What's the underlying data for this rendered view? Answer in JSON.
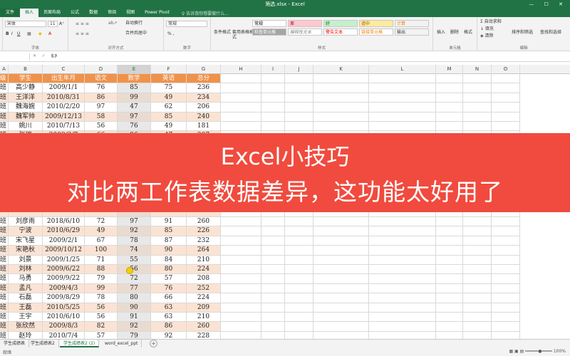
{
  "window": {
    "title": "筛选.xlsx - Excel",
    "controls": "— ☐ ✕"
  },
  "menu": {
    "file": "文件",
    "tabs": [
      "插入",
      "页面布局",
      "公式",
      "数据",
      "审阅",
      "视图",
      "Power Pivot"
    ],
    "active_index": 0,
    "tell_me": "♀ 告诉我你想要做什么..."
  },
  "ribbon": {
    "clipboard": {
      "paste": "粘贴",
      "cut": "✂",
      "copy": "⎘",
      "painter": "🖌"
    },
    "font": {
      "name": "宋体",
      "size": "11",
      "grow": "A⁺",
      "shrink": "A⁻",
      "bold": "B",
      "italic": "I",
      "underline": "U",
      "label": "字体"
    },
    "align": {
      "wrap": "自动换行",
      "merge": "合并后居中",
      "label": "对齐方式"
    },
    "number": {
      "format": "常规",
      "percent": "% ,",
      "label": "数字"
    },
    "styles": {
      "cond": "条件格式",
      "table": "套用表格格式",
      "label": "样式",
      "cells": [
        {
          "text": "常规",
          "bg": "#ffffff",
          "fg": "#000000"
        },
        {
          "text": "差",
          "bg": "#ffc7ce",
          "fg": "#9c0006"
        },
        {
          "text": "好",
          "bg": "#c6efce",
          "fg": "#006100"
        },
        {
          "text": "适中",
          "bg": "#ffeb9c",
          "fg": "#9c5700"
        },
        {
          "text": "计算",
          "bg": "#f2f2f2",
          "fg": "#fa7d00"
        },
        {
          "text": "检查单元格",
          "bg": "#a5a5a5",
          "fg": "#ffffff"
        },
        {
          "text": "解释性文本",
          "bg": "#ffffff",
          "fg": "#7f7f7f"
        },
        {
          "text": "警告文本",
          "bg": "#ffffff",
          "fg": "#ff0000"
        },
        {
          "text": "链接单元格",
          "bg": "#ffffff",
          "fg": "#fa7d00"
        },
        {
          "text": "输出",
          "bg": "#f2f2f2",
          "fg": "#3f3f3f"
        }
      ]
    },
    "cellsgrp": {
      "insert": "插入",
      "delete": "删除",
      "format": "格式",
      "label": "单元格"
    },
    "editing": {
      "autosum": "Σ 自动求和",
      "fill": "↓ 填充",
      "clear": "◈ 清除",
      "sort": "排序和筛选",
      "find": "查找和选择",
      "label": "编辑"
    }
  },
  "formula": {
    "namebox": "",
    "fx": "✕ ✓ fx",
    "value": "67"
  },
  "columns": [
    {
      "id": "",
      "w": 0
    },
    {
      "id": "A",
      "w": 0
    },
    {
      "id": "B",
      "w": 0
    },
    {
      "id": "C",
      "w": 0
    },
    {
      "id": "D",
      "w": 0
    },
    {
      "id": "E",
      "w": 0
    },
    {
      "id": "F",
      "w": 0
    },
    {
      "id": "G",
      "w": 0
    },
    {
      "id": "H",
      "w": 0
    },
    {
      "id": "I",
      "w": 0
    },
    {
      "id": "J",
      "w": 0
    },
    {
      "id": "K",
      "w": 0
    },
    {
      "id": "L",
      "w": 0
    },
    {
      "id": "M",
      "w": 0
    },
    {
      "id": "N",
      "w": 0
    },
    {
      "id": "O",
      "w": 0
    }
  ],
  "selected_column": "E",
  "table": {
    "header": [
      "级",
      "学生",
      "出生年月",
      "语文",
      "数学",
      "英语",
      "总分"
    ],
    "rows": [
      [
        "班",
        "高少静",
        "2009/1/1",
        "76",
        "85",
        "75",
        "236"
      ],
      [
        "班",
        "王洋洋",
        "2010/8/31",
        "86",
        "99",
        "49",
        "234"
      ],
      [
        "班",
        "魏海婉",
        "2010/2/20",
        "97",
        "47",
        "62",
        "206"
      ],
      [
        "班",
        "魏军帅",
        "2009/12/13",
        "58",
        "97",
        "85",
        "240"
      ],
      [
        "班",
        "姚川",
        "2010/7/13",
        "56",
        "76",
        "49",
        "181"
      ],
      [
        "班",
        "张瑞",
        "2009/3/7",
        "66",
        "96",
        "47",
        "207"
      ],
      [
        "",
        "",
        "",
        "",
        "",
        "",
        ""
      ],
      [
        "",
        "",
        "",
        "",
        "",
        "",
        ""
      ],
      [
        "",
        "",
        "",
        "",
        "",
        "",
        ""
      ],
      [
        "",
        "",
        "",
        "",
        "",
        "",
        ""
      ],
      [
        "",
        "",
        "",
        "",
        "",
        "",
        ""
      ],
      [
        "",
        "",
        "",
        "",
        "",
        "",
        ""
      ],
      [
        "",
        "",
        "",
        "",
        "",
        "",
        ""
      ],
      [
        "",
        "",
        "",
        "",
        "",
        "",
        ""
      ],
      [
        "班",
        "刘彦雨",
        "2018/6/10",
        "72",
        "97",
        "91",
        "260"
      ],
      [
        "班",
        "宁波",
        "2010/6/29",
        "49",
        "92",
        "85",
        "226"
      ],
      [
        "班",
        "宋飞星",
        "2009/2/1",
        "67",
        "78",
        "87",
        "232"
      ],
      [
        "班",
        "宋艳秋",
        "2009/10/12",
        "100",
        "74",
        "90",
        "264"
      ],
      [
        "班",
        "刘景",
        "2009/1/25",
        "71",
        "55",
        "84",
        "210"
      ],
      [
        "班",
        "刘林",
        "2009/6/22",
        "88",
        "56",
        "80",
        "224"
      ],
      [
        "班",
        "马勇",
        "2009/9/22",
        "79",
        "72",
        "57",
        "208"
      ],
      [
        "班",
        "孟凡",
        "2009/4/3",
        "99",
        "77",
        "76",
        "252"
      ],
      [
        "班",
        "石磊",
        "2009/8/29",
        "78",
        "80",
        "66",
        "224"
      ],
      [
        "班",
        "王磊",
        "2010/5/25",
        "56",
        "90",
        "63",
        "209"
      ],
      [
        "班",
        "王宇",
        "2010/6/10",
        "56",
        "91",
        "63",
        "210"
      ],
      [
        "班",
        "张欣然",
        "2009/8/3",
        "82",
        "92",
        "86",
        "260"
      ],
      [
        "班",
        "赵玲",
        "2010/7/4",
        "57",
        "79",
        "92",
        "228"
      ]
    ]
  },
  "banner": {
    "line1": "Excel小技巧",
    "line2": "对比两工作表数据差异，这功能太好用了"
  },
  "sheets": {
    "tabs": [
      "学生成绩表",
      "学生成绩表2",
      "学生成绩表2 (2)",
      "word_excel_ppt"
    ],
    "active_index": 2,
    "add": "+"
  },
  "status": {
    "left": "就绪",
    "right": "▦ ▣ ▤  ━━━━━●━━━━  100%"
  }
}
